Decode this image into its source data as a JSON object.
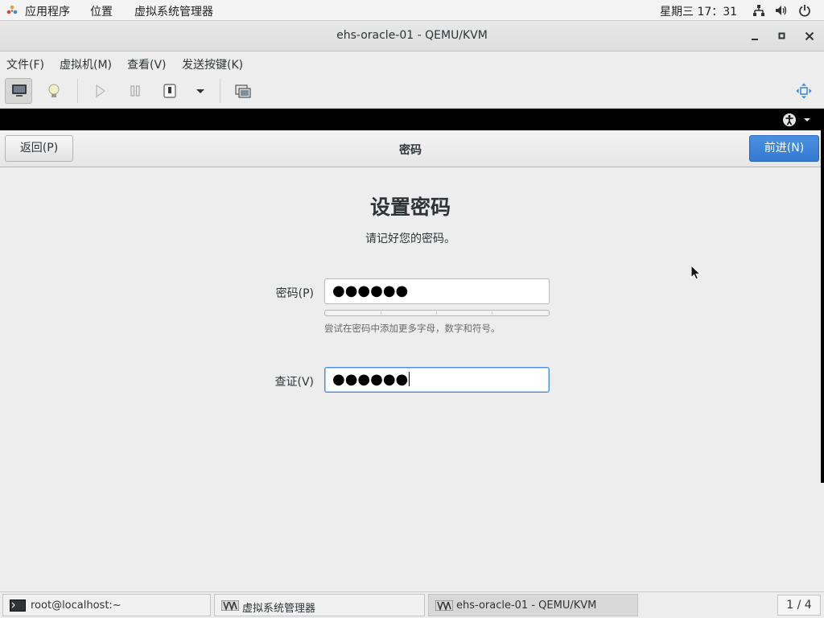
{
  "topbar": {
    "apps_label": "应用程序",
    "places_label": "位置",
    "app_label": "虚拟系统管理器",
    "clock": "星期三 17：31"
  },
  "window": {
    "title": "ehs-oracle-01 - QEMU/KVM"
  },
  "menubar": {
    "items": [
      {
        "label": "文件(F)"
      },
      {
        "label": "虚拟机(M)"
      },
      {
        "label": "查看(V)"
      },
      {
        "label": "发送按键(K)"
      }
    ]
  },
  "installer": {
    "back_label": "返回(P)",
    "header_title": "密码",
    "next_label": "前进(N)",
    "heading": "设置密码",
    "subtitle": "请记好您的密码。",
    "password_label": "密码(P)",
    "password_value": "●●●●●●",
    "strength_hint": "尝试在密码中添加更多字母，数字和符号。",
    "strength_level": 0,
    "verify_label": "查证(V)",
    "verify_value": "●●●●●●"
  },
  "taskbar": {
    "tasks": [
      {
        "label": "root@localhost:~"
      },
      {
        "label": "虚拟系统管理器"
      },
      {
        "label": "ehs-oracle-01 - QEMU/KVM"
      }
    ],
    "workspace": "1 / 4"
  },
  "colors": {
    "accent": "#3a82d8",
    "focus": "#4a90d9"
  }
}
